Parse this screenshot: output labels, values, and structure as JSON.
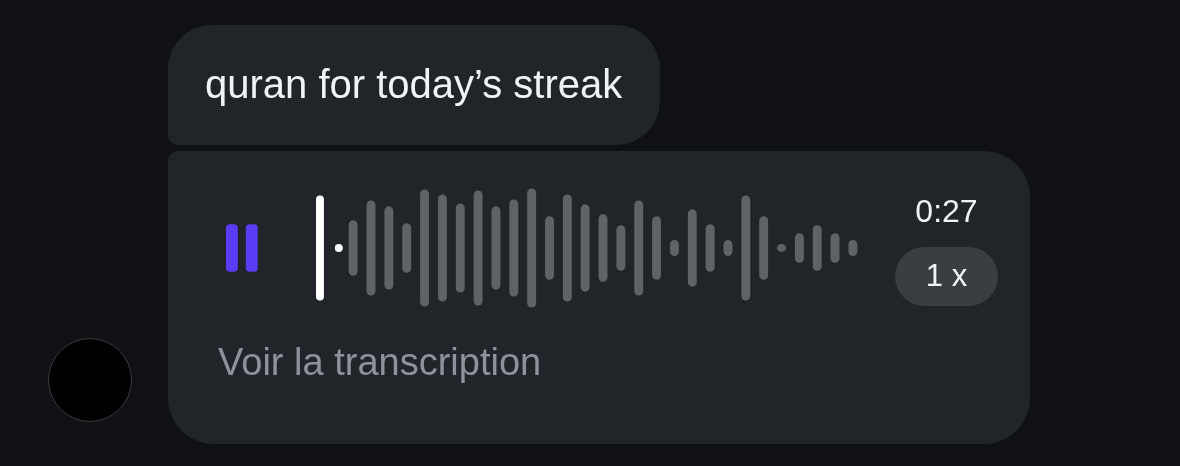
{
  "messages": [
    {
      "kind": "text",
      "text": "quran for today’s streak"
    },
    {
      "kind": "voice",
      "playing": true,
      "duration": "0:27",
      "speed": "1 x",
      "transcript_link": "Voir la transcription"
    }
  ]
}
